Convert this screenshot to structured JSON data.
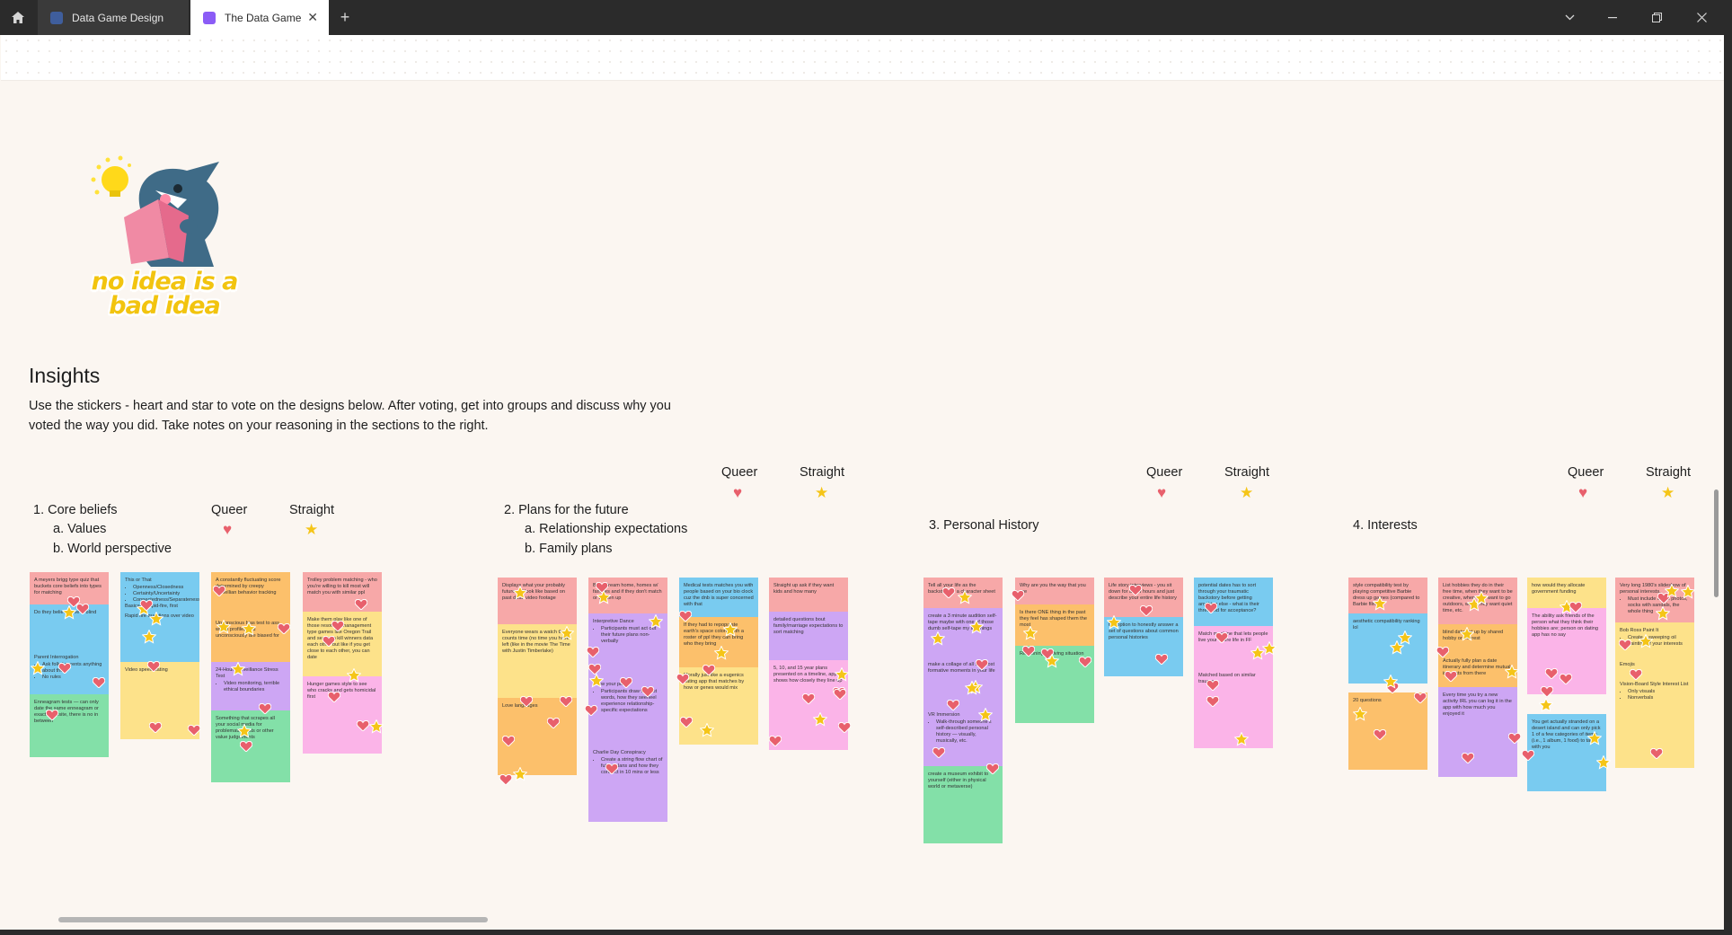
{
  "tabs": [
    {
      "label": "Data Game Design",
      "icon": "figjam-file-icon",
      "active": false
    },
    {
      "label": "The Data Game",
      "icon": "figjam-file-icon",
      "active": true
    }
  ],
  "window": {
    "home_icon": "home-icon",
    "new_tab_icon": "plus-icon",
    "controls": [
      "chevron-down-icon",
      "minimize-icon",
      "restore-icon",
      "close-icon"
    ]
  },
  "colors": {
    "pink": "#f7a8a8",
    "blue": "#79cbf0",
    "orange": "#fcc06b",
    "yellow": "#fde28a",
    "green": "#83e0a8",
    "purple": "#cda6f4",
    "lightpink": "#fbb4e8",
    "heart": "#e8606c",
    "star": "#f5c518"
  },
  "sticker": {
    "text": "no idea is a bad idea",
    "icon": "shark-reading-book-sticker"
  },
  "insights": {
    "title": "Insights",
    "description": "Use the stickers - heart and star to vote on the designs below. After voting, get into groups and discuss why you voted the way you did. Take notes on your reasoning in the sections to the right."
  },
  "vote_labels": {
    "queer": "Queer",
    "straight": "Straight"
  },
  "sections": [
    {
      "title": "1.  Core beliefs",
      "subs": [
        "a.  Values",
        "b.  World perspective"
      ],
      "columns": [
        [
          {
            "color": "pink",
            "text": "A meyers brigg type quiz that buckets core beliefs into types for matching"
          },
          {
            "color": "blue",
            "text": "Do they believe love is blind"
          },
          {
            "color": "blue",
            "text": "Parent Interrogation",
            "bullets": [
              "Ask folks' parents anything about them",
              "No rules"
            ]
          },
          {
            "color": "green",
            "text": "Enneagram tests — can only date the same enneagram or exact opposite, there is no in between"
          }
        ],
        [
          {
            "color": "blue",
            "text": "This or That",
            "bullets": [
              "Openness/Closedness",
              "Certainty/Uncertainty",
              "Connectedness/Separateness"
            ],
            "tail": "Basically, rapid-fire, first impression q&a"
          },
          {
            "color": "blue",
            "text": "Rapid fire questions over video"
          },
          {
            "color": "yellow",
            "text": "Video speed dating"
          }
        ],
        [
          {
            "color": "orange",
            "text": "A constantly fluctuating score determined by creepy Orwellian behavior tracking"
          },
          {
            "color": "orange",
            "text": "Unconscious bias test to ass which profiles you unconsciously are biased for"
          },
          {
            "color": "purple",
            "text": "24-Hour Surveillance Stress Test",
            "bullets": [
              "Video monitoring, terrible ethical boundaries"
            ]
          },
          {
            "color": "green",
            "text": "Something that scrapes all your social media for problematic posts or other value judgements"
          }
        ],
        [
          {
            "color": "pink",
            "text": "Trolley problem matching - who you're willing to kill most will match you with similar ppl"
          },
          {
            "color": "yellow",
            "text": "Make them play like one of those resource management type games like Oregon Trail and see who kill winners data each other but like if you get close to each other, you can date"
          },
          {
            "color": "lightpink",
            "text": "Hunger games style to see who cracks and gets homicidal first"
          }
        ]
      ]
    },
    {
      "title": "2.  Plans for the future",
      "subs": [
        "a.  Relationship expectations",
        "b.  Family plans"
      ],
      "columns": [
        [
          {
            "color": "pink",
            "text": "Displays what your probably future will look like based on past data! video footage"
          },
          {
            "color": "yellow",
            "text": "Everyone wears a watch that counts time (no time you have left (like in the movie The Time with Justin Timberlake)"
          },
          {
            "color": "orange",
            "text": "Love languages"
          }
        ],
        [
          {
            "color": "pink",
            "text": "Build dream home, homes w/ families and if they don't match or broken up"
          },
          {
            "color": "purple",
            "text": "Interpretive Dance",
            "bullets": [
              "Participants must act out their future plans non-verbally"
            ]
          },
          {
            "color": "purple",
            "text": "Draw your plans",
            "bullets": [
              "Participants draw without words, how they see/feel experience relationship-specific expectations"
            ]
          },
          {
            "color": "purple",
            "text": "Charlie Day Conspiracy",
            "bullets": [
              "Create a string flow chart of future plans and how they connect in 10 mins or less"
            ]
          }
        ],
        [
          {
            "color": "blue",
            "text": "Medical tests matches you with people based on your bio clock cuz the dnb is super concerned with that"
          },
          {
            "color": "orange",
            "text": "If they had to repopulate earth's space colony with a roster of ppl they can bring who they bring"
          },
          {
            "color": "yellow",
            "text": "Morally just like a eugenics dating app that matches by how or genes would mix"
          }
        ],
        [
          {
            "color": "pink",
            "text": "Straight up ask if they want kids and how many"
          },
          {
            "color": "purple",
            "text": "detailed questions bout family/marriage expectations to sort matching"
          },
          {
            "color": "lightpink",
            "text": "5, 10, and 15 year plans presented on a timeline, app shows how closely they line up"
          }
        ]
      ]
    },
    {
      "title": "3.  Personal History",
      "subs": [],
      "columns": [
        [
          {
            "color": "pink",
            "text": "Tell all your life as the backstory of a character sheet"
          },
          {
            "color": "purple",
            "text": "create a 3 minute audition self-tape maybe with one of those dumb self-tape my life things"
          },
          {
            "color": "purple",
            "text": "make a collage of all the most formative moments in your life"
          },
          {
            "color": "purple",
            "text": "VR Immersion",
            "bullets": [
              "Walk-through someone's self-described personal history — visually, musically, etc."
            ]
          },
          {
            "color": "green",
            "text": "create a museum exhibit to yourself (either in physical world or metaverse)"
          }
        ],
        [
          {
            "color": "pink",
            "text": "Why are you the way that you are"
          },
          {
            "color": "orange",
            "text": "Is there ONE thing in the past they feel has shaped them the most"
          },
          {
            "color": "green",
            "text": "Reasoning for living situation"
          }
        ],
        [
          {
            "color": "pink",
            "text": "Life story interviews - you sit down for a few hours and just describe your entire life history"
          },
          {
            "color": "blue",
            "text": "the option to honestly answer a set of questions about common personal histories"
          }
        ],
        [
          {
            "color": "blue",
            "text": "potential dates has to sort through your traumatic backstory before getting anything else - what is their threshold for acceptance?"
          },
          {
            "color": "lightpink",
            "text": "Match machine that lets people live your entire life in FF"
          },
          {
            "color": "lightpink",
            "text": "Matched based on similar trauma"
          }
        ]
      ]
    },
    {
      "title": "4.  Interests",
      "subs": [],
      "columns": [
        [
          {
            "color": "pink",
            "text": "style compatibility test by playing competitive Barbie dress up games (compared to Barbie films)"
          },
          {
            "color": "blue",
            "text": "aesthetic compatibility ranking lol"
          },
          {
            "color": "orange",
            "text": "20 questions"
          }
        ],
        [
          {
            "color": "pink",
            "text": "List hobbies they do in their free time, when they want to be creative, when they want to go outdoors, when they want quiet time, etc."
          },
          {
            "color": "orange",
            "text": "blind date set up by shared hobby or interest"
          },
          {
            "color": "orange",
            "text": "Actually fully plan a date itinerary and determine mutual interests from there"
          },
          {
            "color": "purple",
            "text": "Every time you try a new activity IRL you can log it in the app with how much you enjoyed it"
          }
        ],
        [
          {
            "color": "yellow",
            "text": "how would they allocate government funding"
          },
          {
            "color": "lightpink",
            "text": "The ability ask friends of the person what they think their hobbies are; person on dating app has no say"
          },
          {
            "color": "blue",
            "text": "You get actually stranded on a desert island and can only pick 1 of a few categories of items (i.e., 1 album, 1 food) to take with you"
          }
        ],
        [
          {
            "color": "pink",
            "text": "Very long 1980's slideshow of personal interests.",
            "bullets": [
              "Must include travel photos, socks with sandals, the whole thing"
            ]
          },
          {
            "color": "yellow",
            "text": "Bob Ross Paint It",
            "bullets": [
              "Create a sweeping oil painting of your interests"
            ]
          },
          {
            "color": "yellow",
            "text": "Emojis"
          },
          {
            "color": "yellow",
            "text": "Vision-Board Style Interest List",
            "bullets": [
              "Only visuals",
              "Nonverbals"
            ]
          }
        ]
      ]
    }
  ]
}
